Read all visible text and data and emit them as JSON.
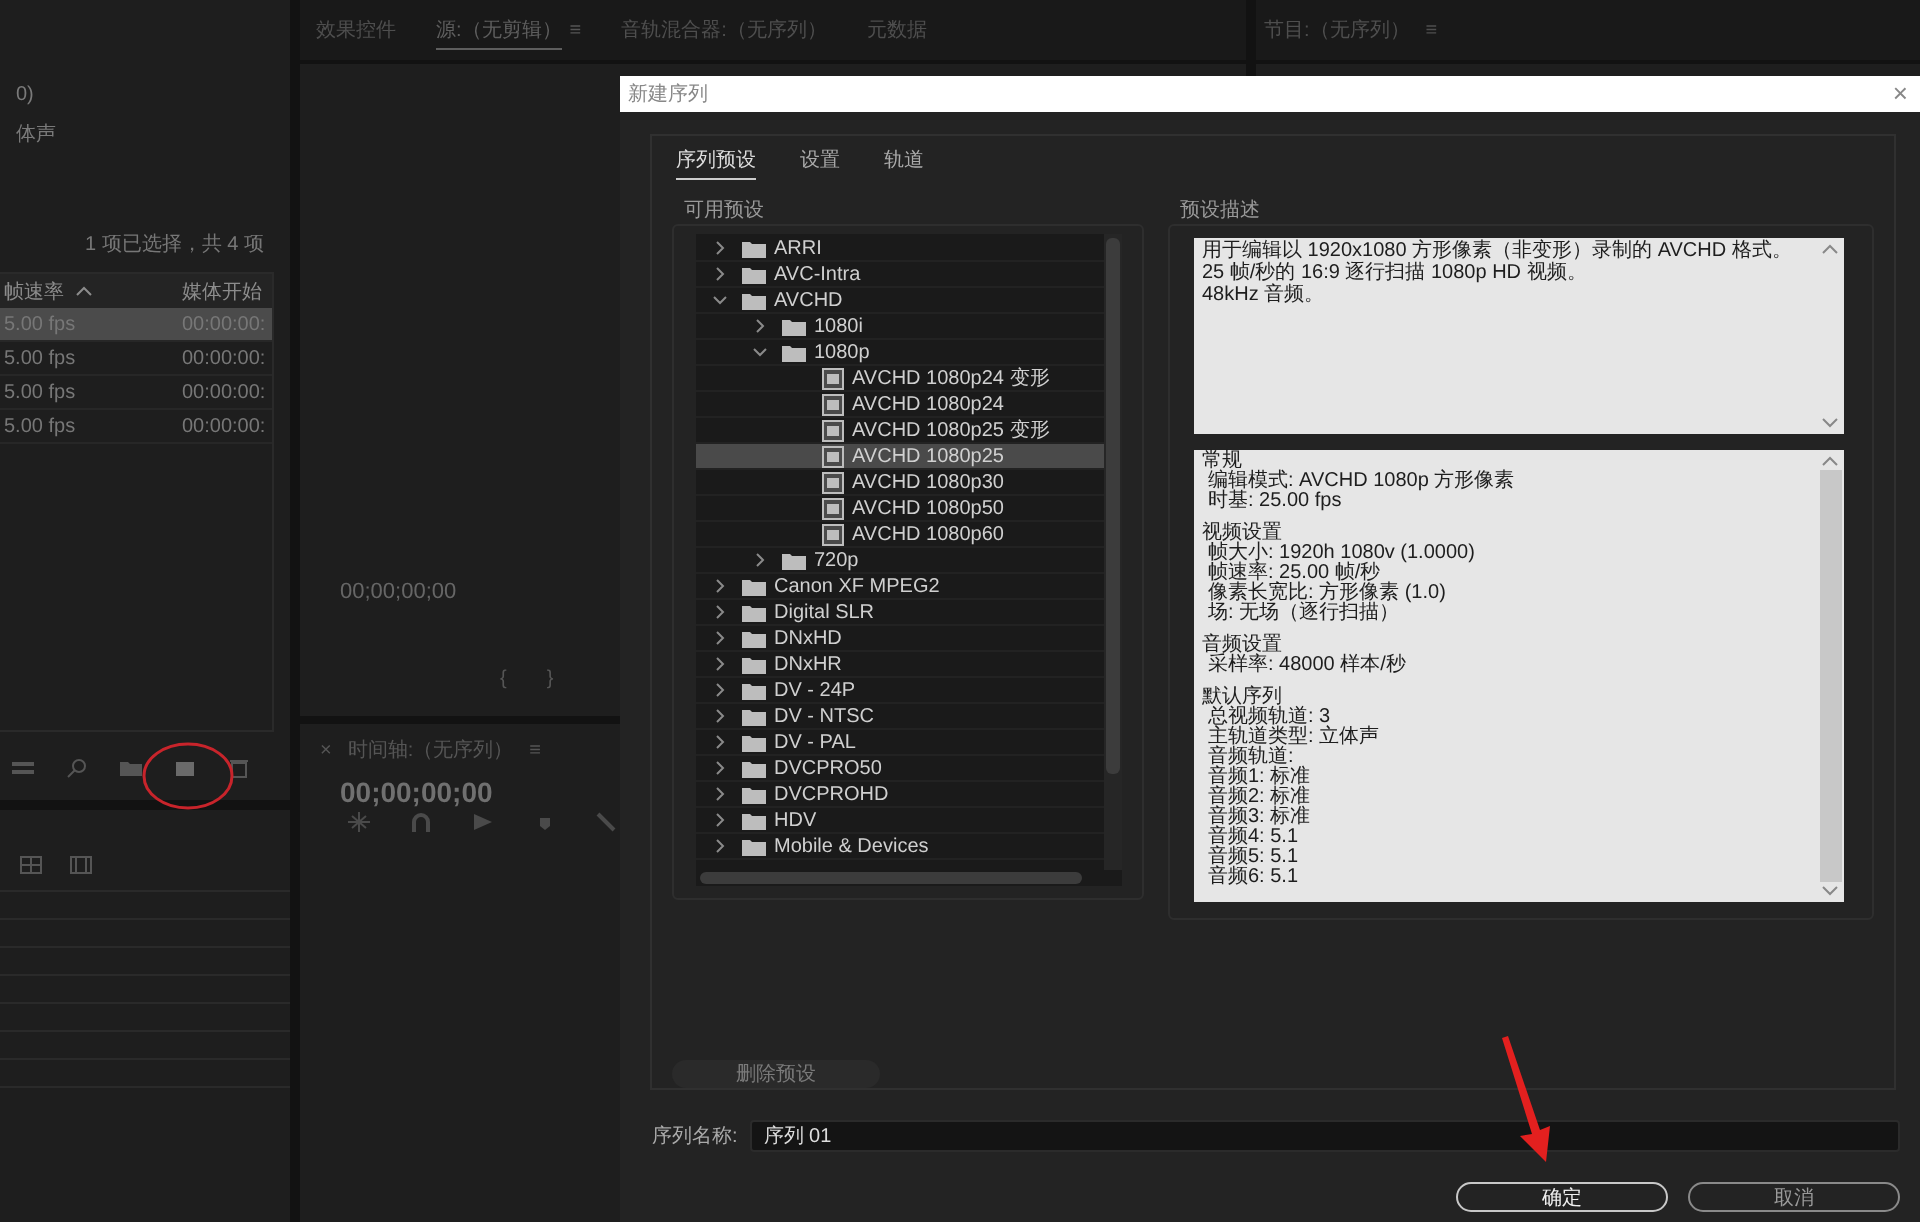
{
  "workspace": {
    "project": {
      "info_lines": [
        "0)",
        "体声"
      ],
      "selection_info": "1 项已选择，共 4 项",
      "columns": [
        "帧速率",
        "媒体开始"
      ],
      "rows": [
        {
          "cells": [
            "5.00 fps",
            "00:00:00:"
          ],
          "selected": true
        },
        {
          "cells": [
            "5.00 fps",
            "00:00:00:"
          ],
          "selected": false
        },
        {
          "cells": [
            "5.00 fps",
            "00:00:00:"
          ],
          "selected": false
        },
        {
          "cells": [
            "5.00 fps",
            "00:00:00:"
          ],
          "selected": false
        }
      ]
    },
    "panel_tabs": [
      {
        "label": "效果控件",
        "selected": false
      },
      {
        "label": "源:（无剪辑）",
        "selected": true,
        "menu": "≡"
      },
      {
        "label": "音轨混合器:（无序列）",
        "selected": false
      },
      {
        "label": "元数据",
        "selected": false
      }
    ],
    "source": {
      "timecode": "00;00;00;00",
      "in_mark": "{",
      "out_mark": "}"
    },
    "timeline": {
      "close": "×",
      "title": "时间轴:（无序列）",
      "menu": "≡",
      "timecode": "00;00;00;00"
    },
    "program": {
      "title": "节目:（无序列）",
      "menu": "≡"
    }
  },
  "dialog": {
    "title": "新建序列",
    "close": "×",
    "tabs": [
      {
        "label": "序列预设",
        "selected": true
      },
      {
        "label": "设置",
        "selected": false
      },
      {
        "label": "轨道",
        "selected": false
      }
    ],
    "presets_label": "可用预设",
    "presets": [
      {
        "kind": "folder",
        "label": "ARRI",
        "expanded": false,
        "selected": false
      },
      {
        "kind": "folder",
        "label": "AVC-Intra",
        "expanded": false,
        "selected": false
      },
      {
        "kind": "folder",
        "label": "AVCHD",
        "expanded": true,
        "selected": false,
        "children": [
          {
            "kind": "folder",
            "label": "1080i",
            "expanded": false,
            "selected": false
          },
          {
            "kind": "folder",
            "label": "1080p",
            "expanded": true,
            "selected": false,
            "children": [
              {
                "kind": "preset",
                "label": "AVCHD 1080p24 变形",
                "selected": false
              },
              {
                "kind": "preset",
                "label": "AVCHD 1080p24",
                "selected": false
              },
              {
                "kind": "preset",
                "label": "AVCHD 1080p25 变形",
                "selected": false
              },
              {
                "kind": "preset",
                "label": "AVCHD 1080p25",
                "selected": true
              },
              {
                "kind": "preset",
                "label": "AVCHD 1080p30",
                "selected": false
              },
              {
                "kind": "preset",
                "label": "AVCHD 1080p50",
                "selected": false
              },
              {
                "kind": "preset",
                "label": "AVCHD 1080p60",
                "selected": false
              }
            ]
          },
          {
            "kind": "folder",
            "label": "720p",
            "expanded": false,
            "selected": false
          }
        ]
      },
      {
        "kind": "folder",
        "label": "Canon XF MPEG2",
        "expanded": false,
        "selected": false
      },
      {
        "kind": "folder",
        "label": "Digital SLR",
        "expanded": false,
        "selected": false
      },
      {
        "kind": "folder",
        "label": "DNxHD",
        "expanded": false,
        "selected": false
      },
      {
        "kind": "folder",
        "label": "DNxHR",
        "expanded": false,
        "selected": false
      },
      {
        "kind": "folder",
        "label": "DV - 24P",
        "expanded": false,
        "selected": false
      },
      {
        "kind": "folder",
        "label": "DV - NTSC",
        "expanded": false,
        "selected": false
      },
      {
        "kind": "folder",
        "label": "DV - PAL",
        "expanded": false,
        "selected": false
      },
      {
        "kind": "folder",
        "label": "DVCPRO50",
        "expanded": false,
        "selected": false
      },
      {
        "kind": "folder",
        "label": "DVCPROHD",
        "expanded": false,
        "selected": false
      },
      {
        "kind": "folder",
        "label": "HDV",
        "expanded": false,
        "selected": false
      },
      {
        "kind": "folder",
        "label": "Mobile & Devices",
        "expanded": false,
        "selected": false
      }
    ],
    "description_label": "预设描述",
    "description": [
      "用于编辑以 1920x1080 方形像素（非变形）录制的 AVCHD 格式。",
      "25 帧/秒的 16:9 逐行扫描 1080p HD 视频。",
      "48kHz 音频。"
    ],
    "details": [
      {
        "heading": "常规",
        "lines": [
          "编辑模式: AVCHD 1080p 方形像素",
          "时基: 25.00 fps"
        ]
      },
      {
        "heading": "视频设置",
        "lines": [
          "帧大小: 1920h 1080v (1.0000)",
          "帧速率: 25.00  帧/秒",
          "像素长宽比: 方形像素 (1.0)",
          "场: 无场（逐行扫描）"
        ]
      },
      {
        "heading": "音频设置",
        "lines": [
          "采样率: 48000 样本/秒"
        ]
      },
      {
        "heading": "默认序列",
        "lines": [
          "总视频轨道: 3",
          "主轨道类型: 立体声",
          "音频轨道:",
          "音频1: 标准",
          "音频2: 标准",
          "音频3: 标准",
          "音频4: 5.1",
          "音频5: 5.1",
          "音频6: 5.1"
        ]
      }
    ],
    "delete_button": {
      "label": "删除预设",
      "disabled": true
    },
    "name_label": "序列名称:",
    "name_value": "序列 01",
    "buttons": [
      {
        "label": "确定",
        "kind": "primary"
      },
      {
        "label": "取消",
        "kind": "secondary"
      }
    ]
  }
}
